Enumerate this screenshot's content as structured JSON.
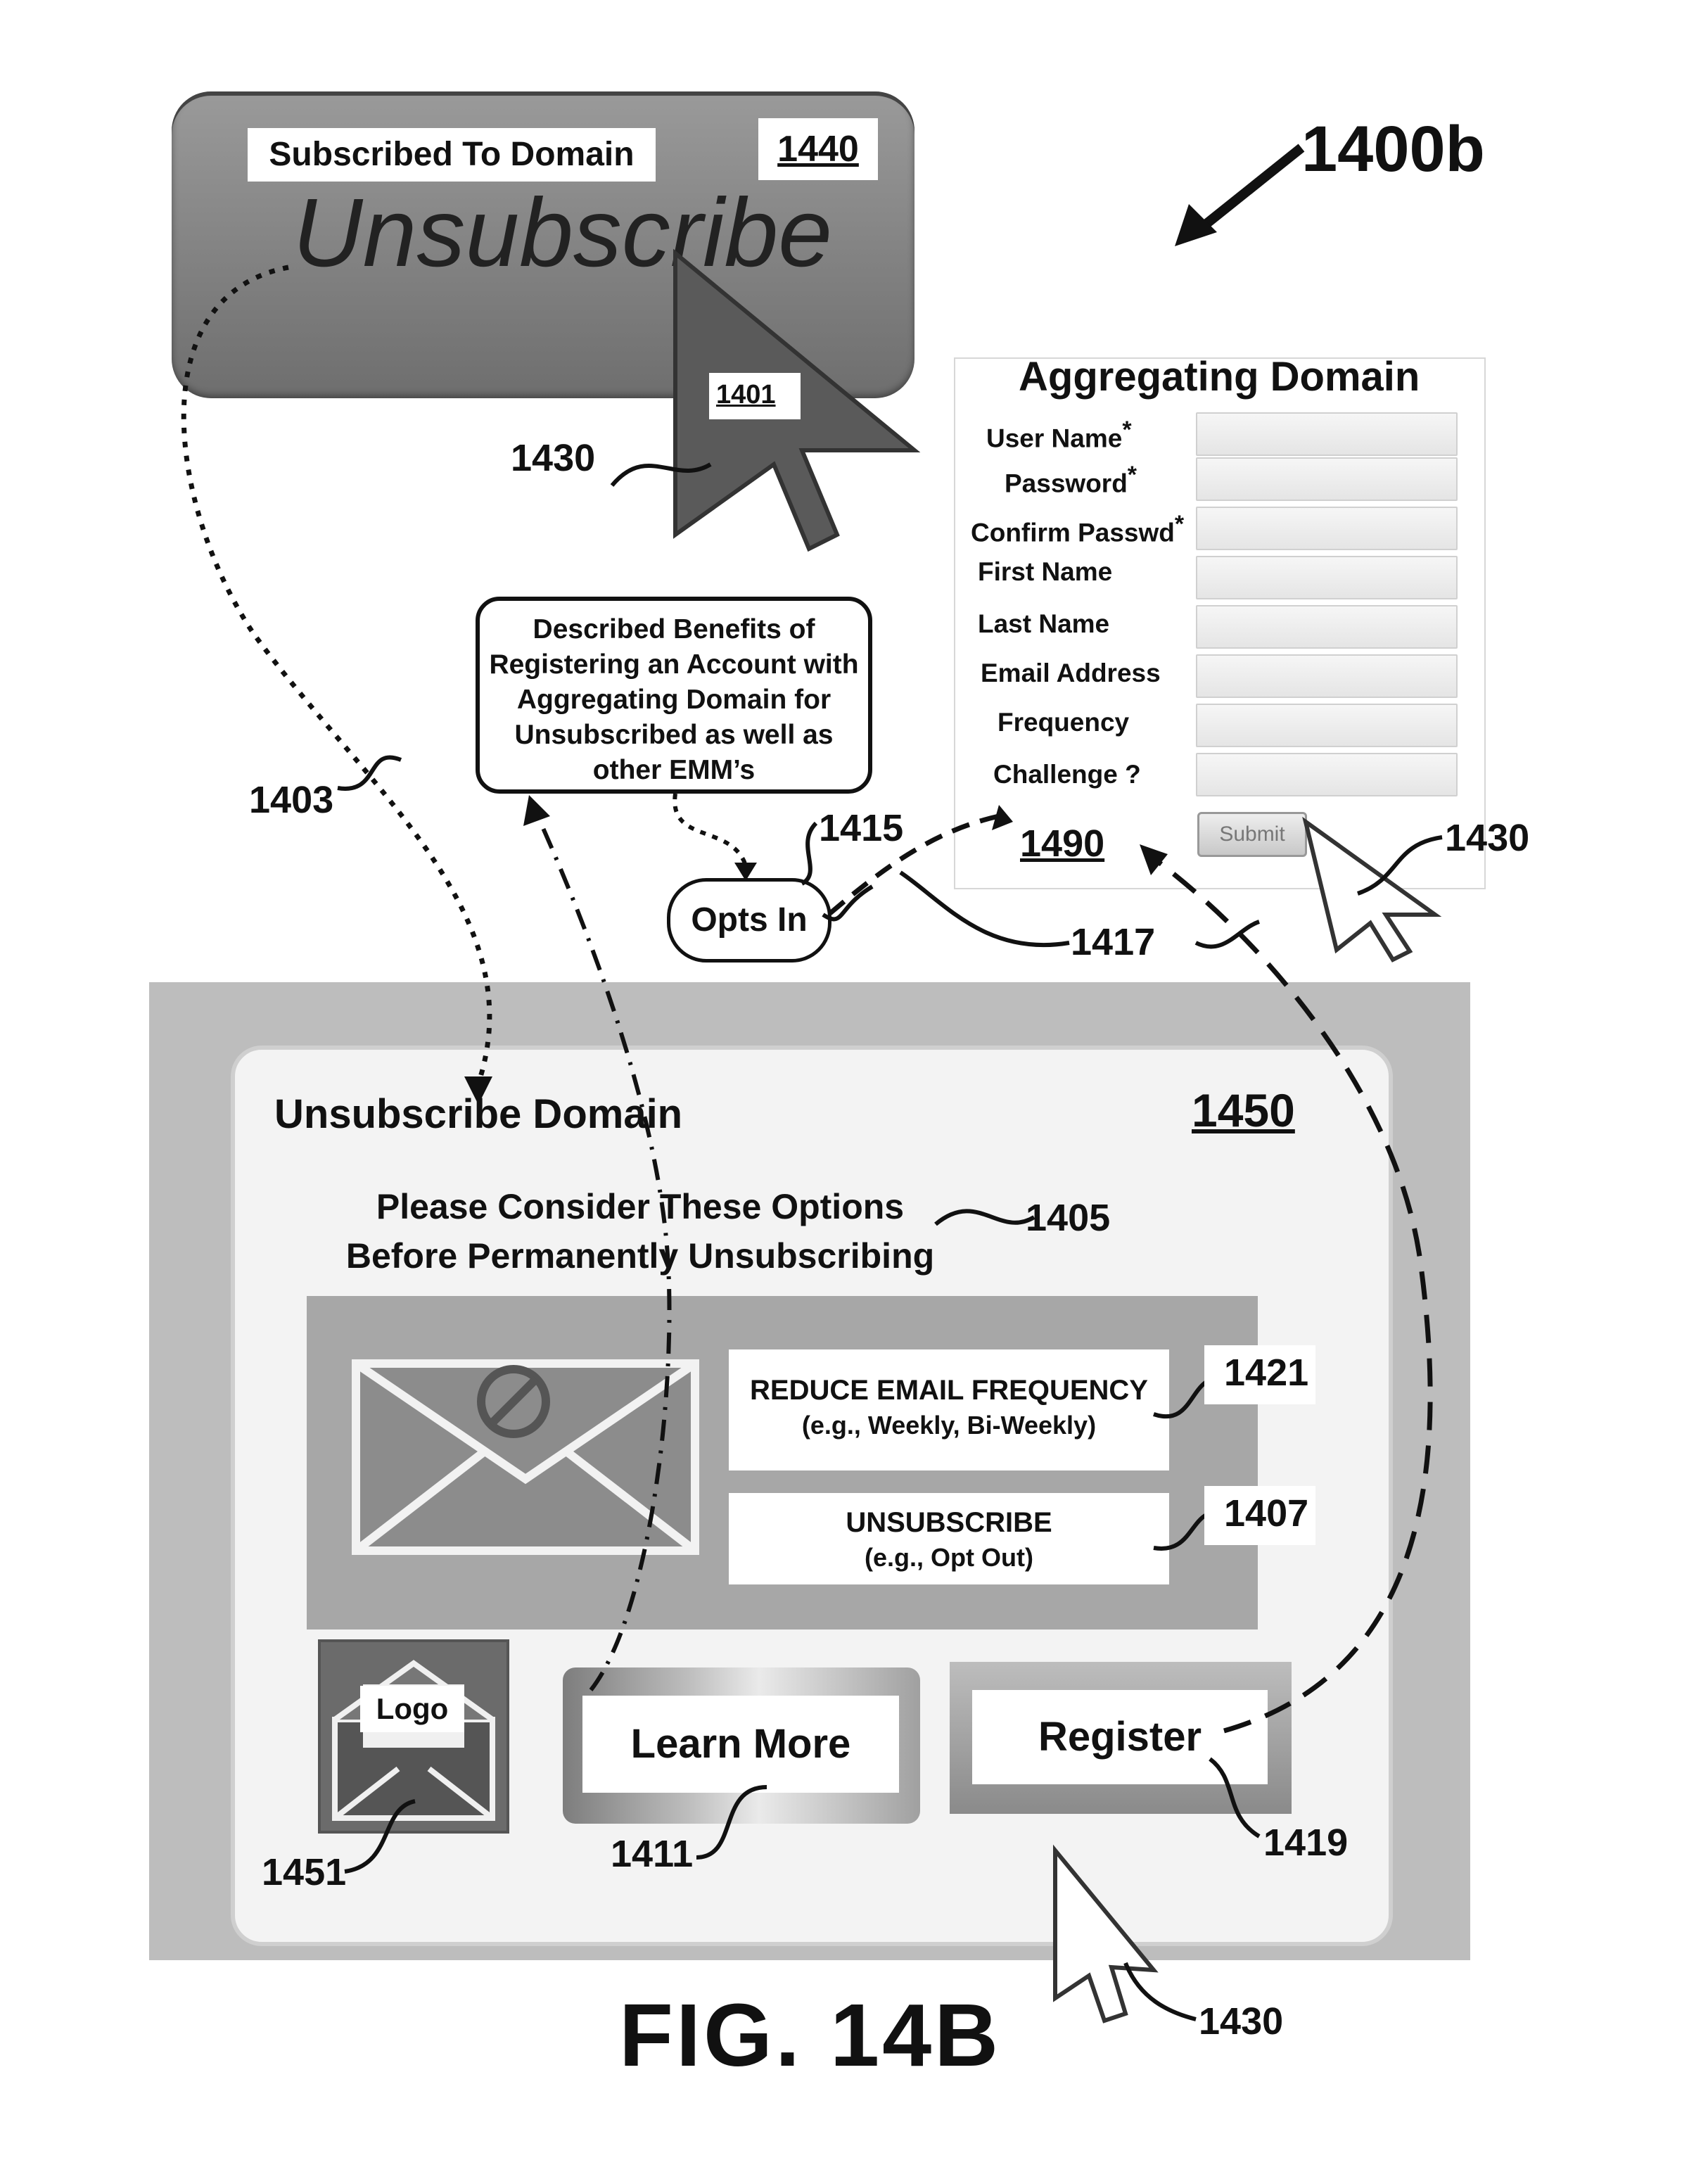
{
  "diagram_ref": "1400b",
  "figure_label": "FIG.  14B",
  "top_panel": {
    "subscribed_label": "Subscribed To Domain",
    "ref_id": "1440",
    "unsubscribe_text": "Unsubscribe",
    "cursor_ref": "1401"
  },
  "aggregating_form": {
    "title": "Aggregating Domain",
    "fields": [
      {
        "label": "User Name",
        "required": "*"
      },
      {
        "label": "Password",
        "required": "*"
      },
      {
        "label": "Confirm Passwd",
        "required": "*"
      },
      {
        "label": "First Name",
        "required": ""
      },
      {
        "label": "Last Name",
        "required": ""
      },
      {
        "label": "Email Address",
        "required": ""
      },
      {
        "label": "Frequency",
        "required": ""
      },
      {
        "label": "Challenge ?",
        "required": ""
      }
    ],
    "submit_label": "Submit",
    "ref_id": "1490"
  },
  "benefits_callout": "Described Benefits of Registering an Account with Aggregating Domain for Unsubscribed as well as other EMM’s",
  "opts_in": "Opts In",
  "unsubscribe_domain": {
    "title": "Unsubscribe Domain",
    "ref_id": "1450",
    "consider_line1": "Please Consider These Options",
    "consider_line2": "Before Permanently Unsubscribing",
    "reduce_option": {
      "main": "REDUCE EMAIL FREQUENCY",
      "sub": "(e.g., Weekly, Bi-Weekly)"
    },
    "unsubscribe_option": {
      "main": "UNSUBSCRIBE",
      "sub": "(e.g., Opt Out)"
    },
    "logo_label": "Logo",
    "learn_more": "Learn More",
    "register": "Register"
  },
  "reference_numerals": {
    "r1430a": "1430",
    "r1430b": "1430",
    "r1430c": "1430",
    "r1403": "1403",
    "r1415": "1415",
    "r1417": "1417",
    "r1405": "1405",
    "r1421": "1421",
    "r1407": "1407",
    "r1451": "1451",
    "r1411": "1411",
    "r1419": "1419"
  }
}
